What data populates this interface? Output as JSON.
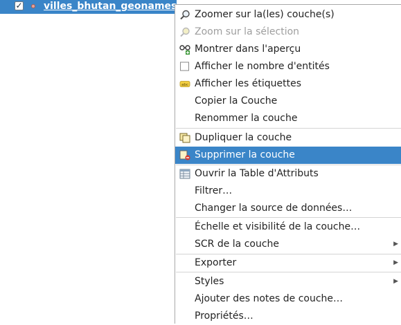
{
  "layer": {
    "checked": true,
    "name": "villes_bhutan_geonames"
  },
  "menu": {
    "items": [
      {
        "label": "Zoomer sur la(les) couche(s)",
        "icon": "zoom-to-layer-icon"
      },
      {
        "label": "Zoom sur la sélection",
        "icon": "zoom-to-selection-icon",
        "disabled": true
      },
      {
        "label": "Montrer dans l'aperçu",
        "icon": "overview-glasses-icon"
      },
      {
        "label": "Afficher le nombre d'entités",
        "icon": "checkbox-icon"
      },
      {
        "label": "Afficher les étiquettes",
        "icon": "labels-abc-icon"
      },
      {
        "label": "Copier la Couche"
      },
      {
        "label": "Renommer la couche"
      },
      {
        "label": "Dupliquer la couche",
        "icon": "duplicate-layer-icon"
      },
      {
        "label": "Supprimer la couche",
        "icon": "remove-layer-icon",
        "highlighted": true
      },
      {
        "label": "Ouvrir la Table d'Attributs",
        "icon": "attribute-table-icon"
      },
      {
        "label": "Filtrer…"
      },
      {
        "label": "Changer la source de données…"
      },
      {
        "label": "Échelle et visibilité de la couche…"
      },
      {
        "label": "SCR de la couche",
        "submenu": true
      },
      {
        "label": "Exporter",
        "submenu": true
      },
      {
        "label": "Styles",
        "submenu": true
      },
      {
        "label": "Ajouter des notes de couche…"
      },
      {
        "label": "Propriétés…"
      }
    ]
  },
  "colors": {
    "highlight": "#3a85c8",
    "text": "#232323",
    "disabled_text": "#9e9e9e"
  }
}
